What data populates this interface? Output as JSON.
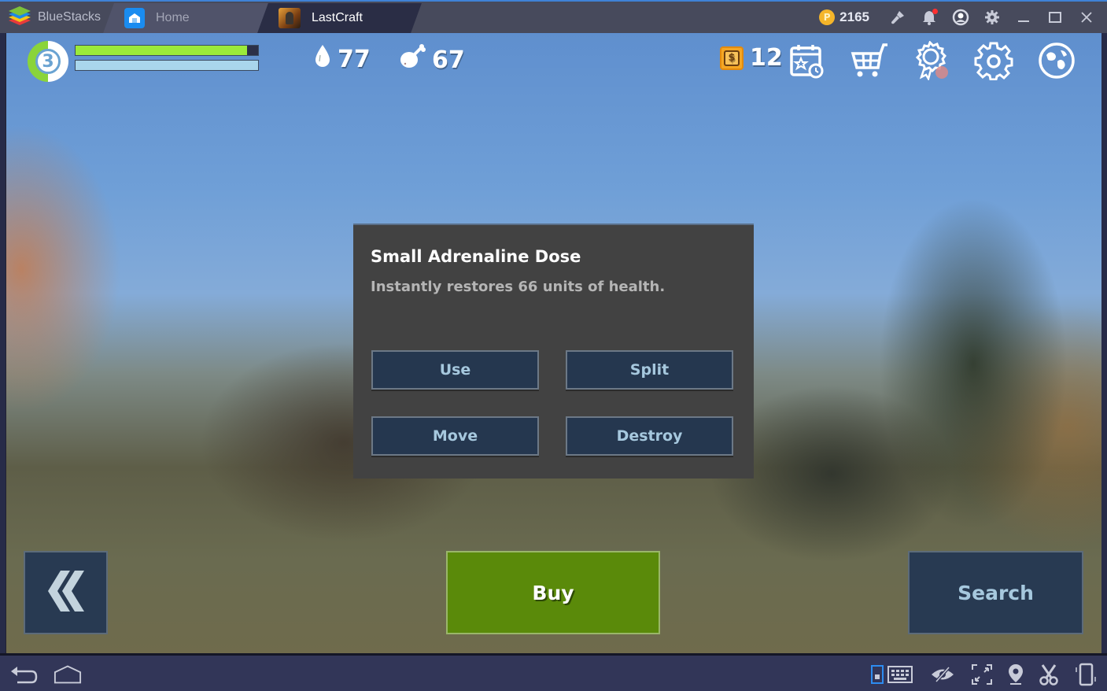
{
  "window": {
    "app_name": "BlueStacks",
    "tabs": [
      {
        "label": "Home",
        "icon": "home-icon",
        "active": false
      },
      {
        "label": "LastCraft",
        "icon": "game-icon",
        "active": true
      }
    ],
    "coins": "2165",
    "coin_symbol": "P",
    "toolbar_icons": [
      "brush-icon",
      "bell-icon",
      "account-icon",
      "settings-icon",
      "minimize-icon",
      "maximize-icon",
      "close-icon"
    ],
    "notification_dot_color": "#ff3030"
  },
  "hud": {
    "level": "3",
    "level_progress": 0.5,
    "health_fraction": 0.94,
    "xp_fraction": 1.0,
    "water": "77",
    "food": "67",
    "cash_symbol": "$",
    "cash": "12",
    "icons": [
      "daily-calendar-icon",
      "shop-cart-icon",
      "achievements-badge-icon",
      "game-settings-icon",
      "world-map-icon"
    ]
  },
  "dialog": {
    "title": "Small Adrenaline Dose",
    "description": "Instantly restores 66 units of health.",
    "buttons": {
      "use": "Use",
      "split": "Split",
      "move": "Move",
      "destroy": "Destroy"
    }
  },
  "bottom": {
    "back_icon": "double-chevron-left-icon",
    "buy": "Buy",
    "search": "Search"
  },
  "navbar": {
    "left_icons": [
      "back-icon",
      "home-icon"
    ],
    "right_icons": [
      "keymap-icon",
      "keyboard-icon",
      "eye-hidden-icon",
      "fullscreen-icon",
      "location-icon",
      "scissors-icon",
      "shake-icon"
    ]
  },
  "colors": {
    "accent_blue": "#3f82d6",
    "buy_green": "#5a8a0a",
    "dialog_bg": "#424242",
    "button_navy": "#25374f",
    "health_green": "#9bea3a",
    "xp_blue": "#a9d6ec"
  }
}
